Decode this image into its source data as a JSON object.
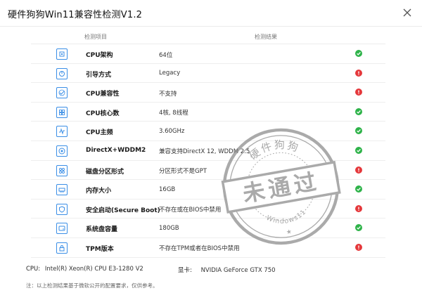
{
  "window": {
    "title": "硬件狗狗Win11兼容性检测V1.2"
  },
  "table": {
    "header_item": "检测项目",
    "header_result": "检测结果",
    "rows": [
      {
        "name": "CPU架构",
        "value": "64位",
        "status": "pass",
        "icon": "cpu-arch-icon"
      },
      {
        "name": "引导方式",
        "value": "Legacy",
        "status": "fail",
        "icon": "boot-icon"
      },
      {
        "name": "CPU兼容性",
        "value": "不支持",
        "status": "fail",
        "icon": "compat-icon"
      },
      {
        "name": "CPU核心数",
        "value": "4核, 8线程",
        "status": "pass",
        "icon": "cores-icon"
      },
      {
        "name": "CPU主频",
        "value": "3.60GHz",
        "status": "pass",
        "icon": "frequency-icon"
      },
      {
        "name": "DirectX+WDDM2",
        "value": "兼容支持DirectX 12, WDDM 2.5",
        "status": "pass",
        "icon": "directx-icon"
      },
      {
        "name": "磁盘分区形式",
        "value": "分区形式不是GPT",
        "status": "fail",
        "icon": "partition-icon"
      },
      {
        "name": "内存大小",
        "value": "16GB",
        "status": "pass",
        "icon": "memory-icon"
      },
      {
        "name": "安全启动(Secure Boot)",
        "value": "不存在或在BIOS中禁用",
        "status": "fail",
        "icon": "secure-boot-icon"
      },
      {
        "name": "系统盘容量",
        "value": "180GB",
        "status": "pass",
        "icon": "disk-icon"
      },
      {
        "name": "TPM版本",
        "value": "不存在TPM或者在BIOS中禁用",
        "status": "fail",
        "icon": "tpm-icon"
      }
    ]
  },
  "hardware": {
    "cpu_label": "CPU:",
    "cpu_value": "Intel(R) Xeon(R) CPU E3-1280 V2",
    "gpu_label": "显卡:",
    "gpu_value": "NVIDIA GeForce GTX 750"
  },
  "note": "注：以上检测结果基于微软公开的配置要求，仅供参考。",
  "stamp": {
    "top_text": "硬件狗狗",
    "main_text": "未通过",
    "bottom_text": "Windows11"
  },
  "colors": {
    "pass": "#2fb34a",
    "fail": "#e5383b",
    "icon_accent": "#3a8ee6",
    "stamp": "#8a8a8a"
  }
}
